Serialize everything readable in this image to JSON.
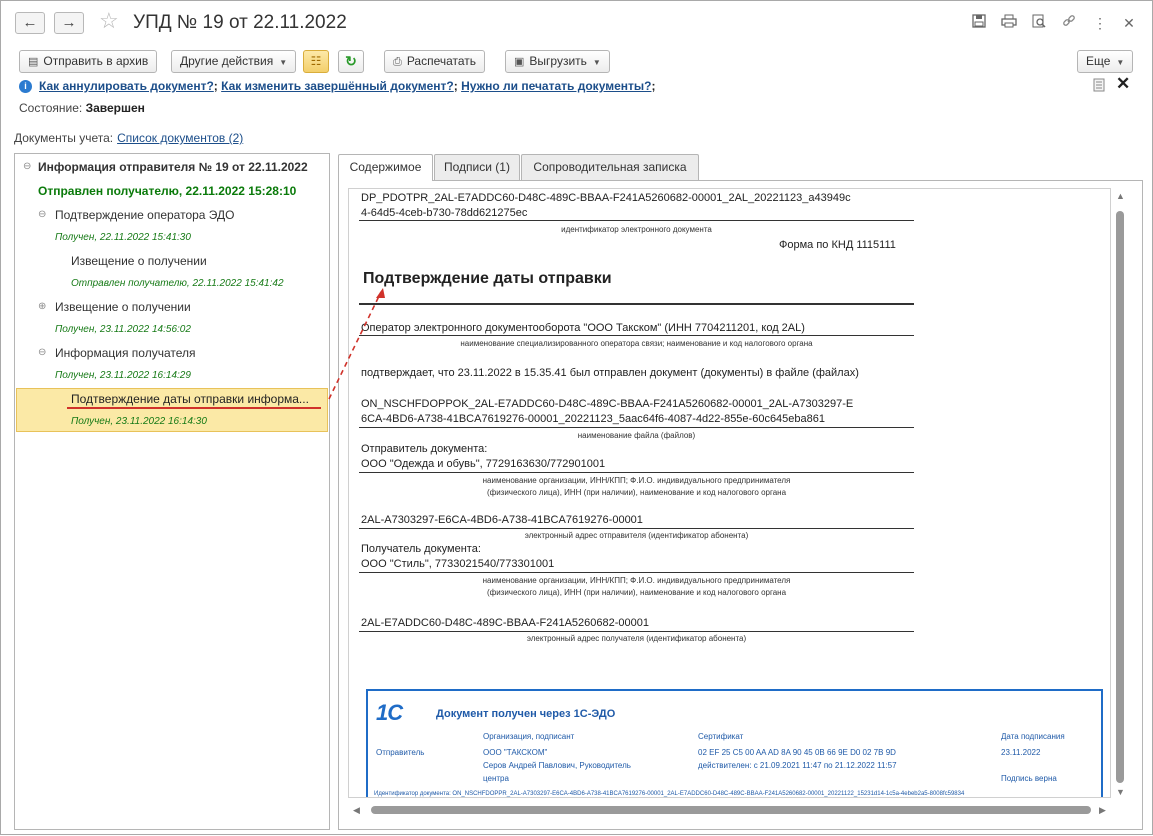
{
  "header": {
    "back_icon": "arrow-left-icon",
    "forward_icon": "arrow-right-icon",
    "favorite_icon": "star-icon",
    "title": "УПД № 19 от 22.11.2022",
    "icons": [
      "save-icon",
      "print-icon",
      "preview-icon",
      "link-icon",
      "more-icon",
      "close-icon"
    ]
  },
  "toolbar": {
    "send_archive": "Отправить в архив",
    "other_actions": "Другие действия",
    "print": "Распечатать",
    "export": "Выгрузить",
    "more": "Еще"
  },
  "help": {
    "link1": "Как аннулировать документ?",
    "link2": "Как изменить завершённый документ?",
    "link3": "Нужно ли печатать документы?"
  },
  "state": {
    "label": "Состояние:",
    "value": "Завершен"
  },
  "docs": {
    "label": "Документы учета:",
    "link": "Список документов (2)"
  },
  "tree": {
    "root": "Информация отправителя № 19 от 22.11.2022",
    "root_status": "Отправлен получателю, 22.11.2022 15:28:10",
    "items": [
      {
        "title": "Подтверждение оператора ЭДО",
        "status": "Получен, 22.11.2022 15:41:30"
      },
      {
        "title": "Извещение о получении",
        "status": "Отправлен получателю, 22.11.2022 15:41:42"
      },
      {
        "title": "Извещение о получении",
        "status": "Получен, 23.11.2022 14:56:02"
      },
      {
        "title": "Информация получателя",
        "status": "Получен, 23.11.2022 16:14:29"
      },
      {
        "title": "Подтверждение даты отправки информа...",
        "status": "Получен, 23.11.2022 16:14:30"
      }
    ]
  },
  "tabs": [
    "Содержимое",
    "Подписи (1)",
    "Сопроводительная записка"
  ],
  "doc": {
    "file_id_line1": "DP_PDOTPR_2AL-E7ADDC60-D48C-489C-BBAA-F241A5260682-00001_2AL_20221123_a43949c",
    "file_id_line2": "4-64d5-4ceb-b730-78dd621275ec",
    "file_id_caption": "идентификатор электронного документа",
    "form": "Форма по КНД 1115111",
    "heading": "Подтверждение даты отправки",
    "operator": "Оператор электронного документооборота \"ООО Такском\" (ИНН 7704211201, код 2AL)",
    "operator_caption": "наименование специализированного оператора связи; наименование и код налогового органа",
    "confirms": "подтверждает, что 23.11.2022 в 15.35.41 был отправлен документ (документы) в файле (файлах)",
    "file_line1": "ON_NSCHFDOPPOK_2AL-E7ADDC60-D48C-489C-BBAA-F241A5260682-00001_2AL-A7303297-E",
    "file_line2": "6CA-4BD6-A738-41BCA7619276-00001_20221123_5aac64f6-4087-4d22-855e-60c645eba861",
    "file_caption": "наименование файла (файлов)",
    "sender_label": "Отправитель документа:",
    "sender_value": "ООО \"Одежда и обувь\", 7729163630/772901001",
    "sender_caption1": "наименование организации, ИНН/КПП; Ф.И.О. индивидуального предпринимателя",
    "sender_caption2": "(физического лица), ИНН (при наличии), наименование и код налогового органа",
    "sender_address": "2AL-A7303297-E6CA-4BD6-A738-41BCA7619276-00001",
    "sender_address_caption": "электронный адрес отправителя (идентификатор абонента)",
    "receiver_label": "Получатель документа:",
    "receiver_value": "ООО \"Стиль\", 7733021540/773301001",
    "receiver_caption1": "наименование организации, ИНН/КПП; Ф.И.О. индивидуального предпринимателя",
    "receiver_caption2": "(физического лица), ИНН (при наличии), наименование и код налогового органа",
    "receiver_address": "2AL-E7ADDC60-D48C-489C-BBAA-F241A5260682-00001",
    "receiver_address_caption": "электронный адрес получателя (идентификатор абонента)"
  },
  "stamp": {
    "logo": "1С",
    "title": "Документ получен через 1С-ЭДО",
    "col_org": "Организация, подписант",
    "col_cert": "Сертификат",
    "col_date": "Дата подписания",
    "role": "Отправитель",
    "org": "ООО \"ТАКСКОМ\"",
    "signer1": "Серов Андрей Павлович, Руководитель",
    "signer2": "центра",
    "cert": "02 EF 25 C5 00 AA AD 8A 90 45 0B 66 9E D0 02 7B 9D",
    "cert_valid": "действителен: с 21.09.2021 11:47 по 21.12.2022 11:57",
    "date": "23.11.2022",
    "sig_ok": "Подпись верна",
    "doc_id": "Идентификатор документа: ON_NSCHFDOPPR_2AL-A7303297-E6CA-4BD6-A738-41BCA7619276-00001_2AL-E7ADDC60-D48C-489C-BBAA-F241A5260682-00001_20221122_15231d14-1c5a-4ebeb2a5-8008fc59834"
  },
  "colors": {
    "accent": "#1f6cc7",
    "selection": "#fbe9a6",
    "status_green": "#167a16",
    "root_status": "#0a7a0a",
    "annotation": "#d0322a"
  }
}
